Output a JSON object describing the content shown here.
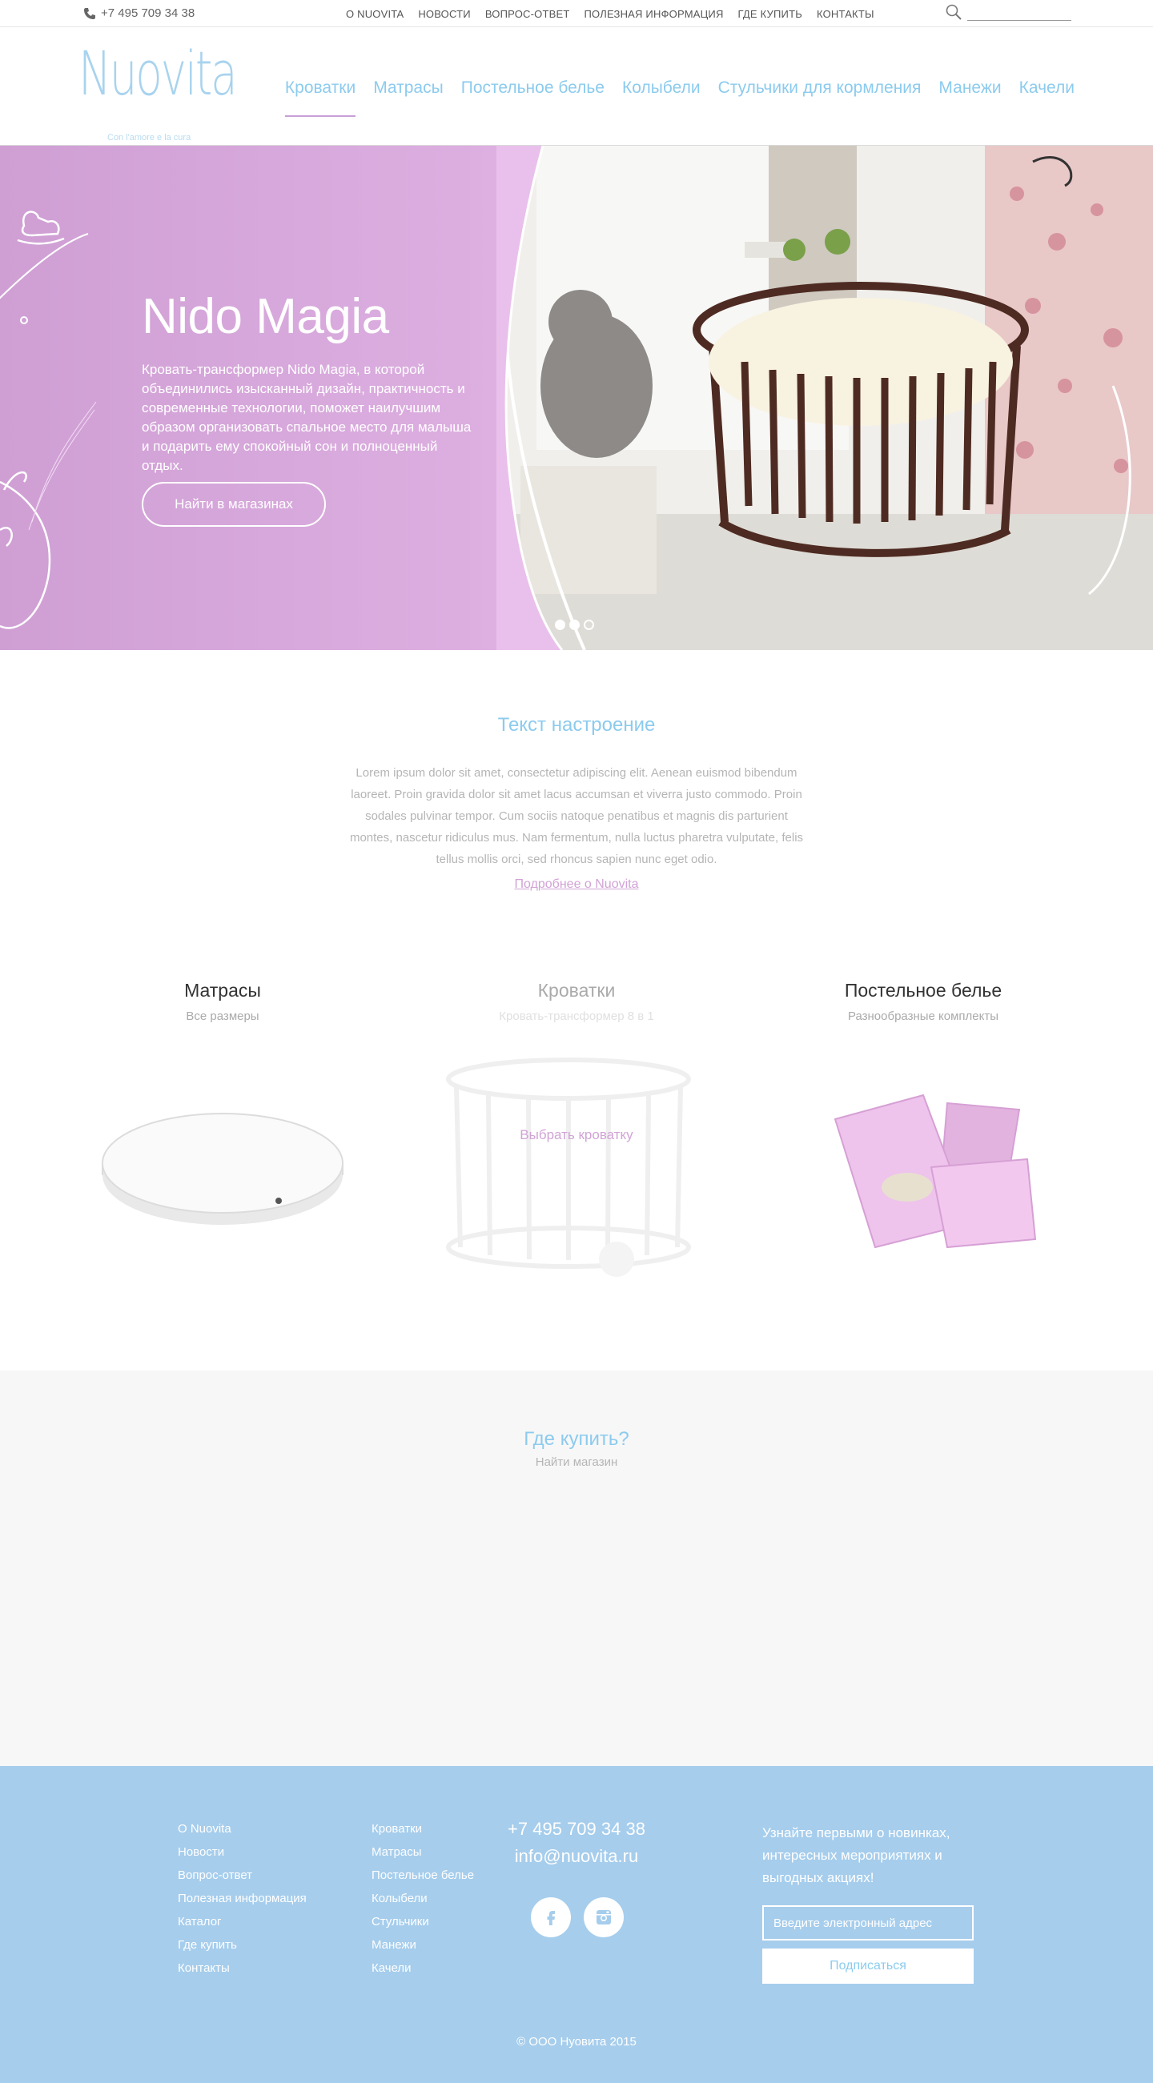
{
  "topbar": {
    "phone": "+7 495 709 34 38",
    "nav": [
      "О NUOVITA",
      "НОВОСТИ",
      "ВОПРОС-ОТВЕТ",
      "ПОЛЕЗНАЯ ИНФОРМАЦИЯ",
      "ГДЕ КУПИТЬ",
      "КОНТАКТЫ"
    ],
    "search_value": ""
  },
  "header": {
    "logo": "Nuovita",
    "tagline": "Con l'amore e la cura",
    "nav": [
      "Кроватки",
      "Матрасы",
      "Постельное белье",
      "Колыбели",
      "Стульчики для кормления",
      "Манежи",
      "Качели"
    ],
    "active_index": 0
  },
  "hero": {
    "title": "Nido Magia",
    "description": "Кровать-трансформер Nido Magia, в которой объединились изысканный дизайн, практичность и современные технологии, поможет наилучшим образом организовать спальное место для малыша и подарить ему спокойный сон и полноценный отдых.",
    "button": "Найти в магазинах"
  },
  "mood": {
    "title": "Текст настроение",
    "text": "Lorem ipsum dolor sit amet, consectetur adipiscing elit. Aenean euismod bibendum laoreet. Proin gravida dolor sit amet lacus accumsan et viverra justo commodo. Proin sodales pulvinar tempor. Cum sociis natoque penatibus et magnis dis parturient montes, nascetur ridiculus mus. Nam fermentum, nulla luctus pharetra vulputate, felis tellus mollis orci, sed rhoncus sapien nunc eget odio.",
    "link": "Подробнее о Nuovita"
  },
  "products": [
    {
      "title": "Матрасы",
      "subtitle": "Все размеры"
    },
    {
      "title": "Кроватки",
      "subtitle": "Кровать-трансформер 8 в 1",
      "cta": "Выбрать кроватку"
    },
    {
      "title": "Постельное белье",
      "subtitle": "Разнообразные комплекты"
    }
  ],
  "where": {
    "title": "Где купить?",
    "subtitle": "Найти магазин"
  },
  "footer": {
    "col1": [
      "О Nuovita",
      "Новости",
      "Вопрос-ответ",
      "Полезная информация",
      "Каталог",
      "Где купить",
      "Контакты"
    ],
    "col2": [
      "Кроватки",
      "Матрасы",
      "Постельное белье",
      "Колыбели",
      "Стульчики",
      "Манежи",
      "Качели"
    ],
    "phone": "+7 495 709 34 38",
    "email": "info@nuovita.ru",
    "social_icons": [
      "facebook-icon",
      "instagram-icon"
    ],
    "subscribe_text": "Узнайте первыми о новинках, интересных мероприятиях и выгодных акциях!",
    "email_placeholder": "Введите электронный адрес",
    "subscribe_button": "Подписаться",
    "copyright": "© ООО Нуовита 2015"
  },
  "colors": {
    "accent_blue": "#8ccbee",
    "accent_pink": "#d1a3d6",
    "hero_bg": "#d7a8dc",
    "footer_bg": "#a6cdec"
  }
}
